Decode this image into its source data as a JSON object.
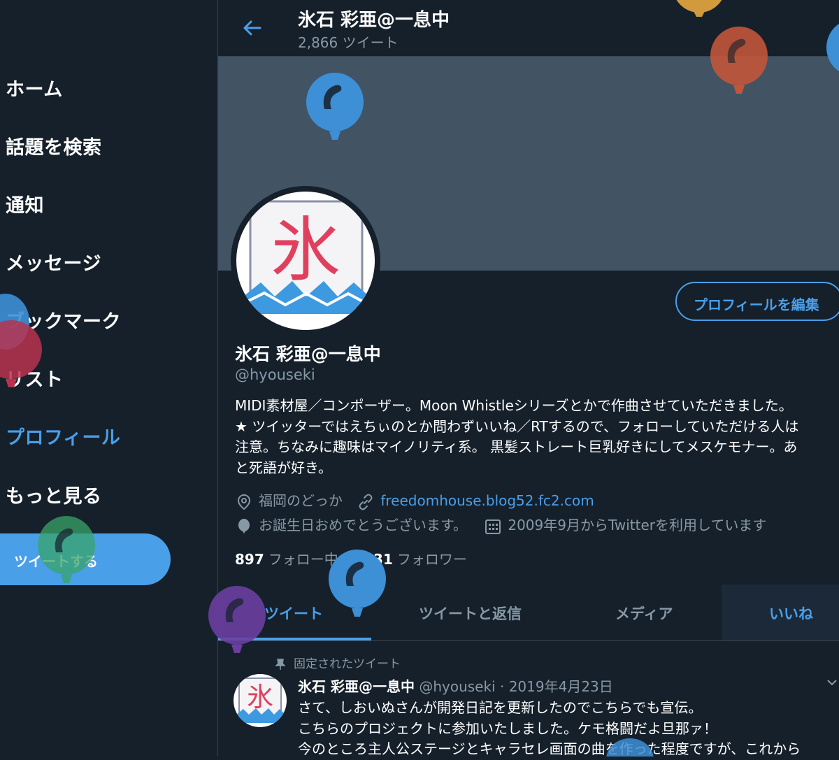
{
  "sidebar": {
    "items": [
      {
        "label": "ホーム"
      },
      {
        "label": "話題を検索"
      },
      {
        "label": "通知"
      },
      {
        "label": "メッセージ"
      },
      {
        "label": "ブックマーク"
      },
      {
        "label": "リスト"
      },
      {
        "label": "プロフィール"
      },
      {
        "label": "もっと見る"
      }
    ],
    "tweet_button": "ツイートする"
  },
  "header": {
    "title": "氷石 彩亜@一息中",
    "tweet_count": "2,866 ツイート"
  },
  "avatar_text": "氷",
  "profile": {
    "edit_button": "プロフィールを編集",
    "name": "氷石 彩亜@一息中",
    "handle": "@hyouseki",
    "bio_lines": [
      "MIDI素材屋／コンポーザー。Moon Whistleシリーズとかで作曲させていただきました。",
      "★ ツイッターではえちぃのとか問わずいいね／RTするので、フォローしていただける人は",
      "注意。ちなみに趣味はマイノリティ系。 黒髪ストレート巨乳好きにしてメスケモナー。あ",
      "と死語が好き。"
    ],
    "location": "福岡のどっか",
    "url": "freedomhouse.blog52.fc2.com",
    "birthday": "お誕生日おめでとうございます。",
    "joined": "2009年9月からTwitterを利用しています",
    "following_count": "897",
    "following_label": "フォロー中",
    "followers_count": "531",
    "followers_label": "フォロワー"
  },
  "tabs": [
    {
      "label": "ツイート"
    },
    {
      "label": "ツイートと返信"
    },
    {
      "label": "メディア"
    },
    {
      "label": "いいね"
    }
  ],
  "pinned_tweet": {
    "pinned_label": "固定されたツイート",
    "name": "氷石 彩亜@一息中",
    "handle": "@hyouseki",
    "separator": "·",
    "date": "2019年4月23日",
    "lines": [
      "さて、しおいぬさんが開発日記を更新したのでこちらでも宣伝。",
      "こちらのプロジェクトに参加いたしました。ケモ格闘だよ旦那ァ！",
      "今のところ主人公ステージとキャラセレ画面の曲を作った程度ですが、これから"
    ]
  },
  "colors": {
    "background": "#15202b",
    "accent": "#4a9fe9",
    "muted": "#8899a6",
    "banner": "#425364"
  },
  "icons": [
    "back-arrow-icon",
    "location-pin-icon",
    "link-icon",
    "balloon-icon",
    "calendar-icon",
    "pin-icon",
    "chevron-down-icon"
  ]
}
